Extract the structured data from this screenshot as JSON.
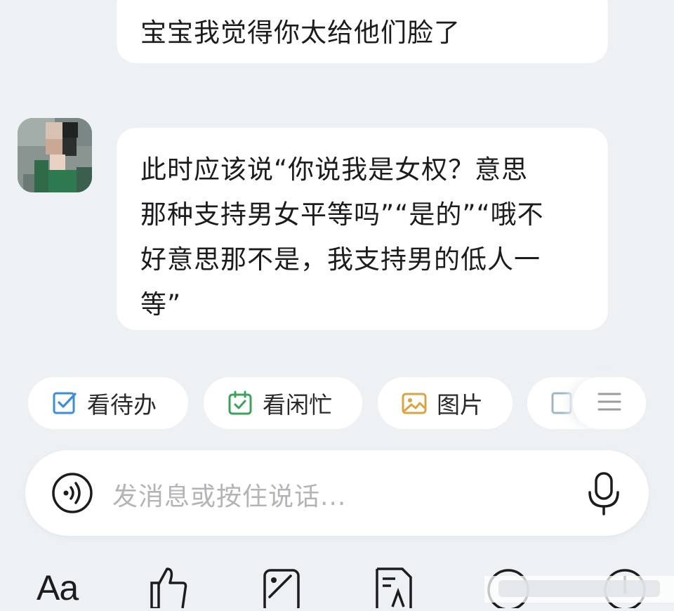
{
  "messages": [
    {
      "text": "宝宝我觉得你太给他们脸了"
    },
    {
      "lines": [
        "此时应该说“你说我是女权？意思",
        "那种支持男女平等吗”“是的”“哦不",
        "好意思那不是，我支持男的低人一",
        "等”"
      ]
    }
  ],
  "quick_actions": [
    {
      "label": "看待办",
      "icon": "checkbox-icon",
      "color": "#3b8fd6"
    },
    {
      "label": "看闲忙",
      "icon": "calendar-check-icon",
      "color": "#3aa35a"
    },
    {
      "label": "图片",
      "icon": "image-icon",
      "color": "#d9a441"
    }
  ],
  "input": {
    "placeholder": "发消息或按住说话..."
  },
  "toolbar": {
    "font_label": "Aa"
  },
  "colors": {
    "background": "#eef1f4",
    "bubble": "#ffffff"
  }
}
